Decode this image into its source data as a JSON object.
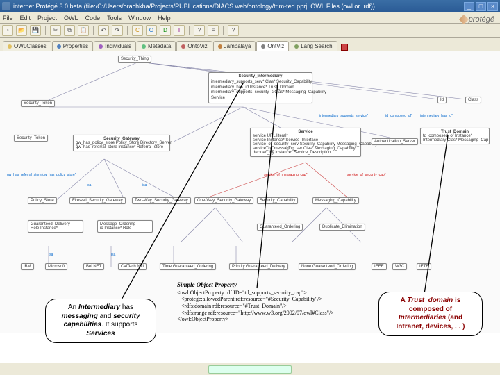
{
  "window": {
    "title": "internet Protégé 3.0 beta   (file:/C:/Users/orachkha/Projects/PUBLications/DIACS.web/ontology/trim-ted.pprj,  OWL Files (owl or .rdf))",
    "min": "_",
    "max": "□",
    "close": "×"
  },
  "menubar": [
    "File",
    "Edit",
    "Project",
    "OWL",
    "Code",
    "Tools",
    "Window",
    "Help"
  ],
  "toolbar_icons": [
    "doc",
    "open",
    "save",
    "sep",
    "cut",
    "copy",
    "paste",
    "sep",
    "undo",
    "redo",
    "sep",
    "c",
    "o",
    "c2",
    "t",
    "sep",
    "q",
    "list",
    "sep",
    "help"
  ],
  "tabs": [
    {
      "label": "OWLClasses",
      "color": "#e0c060"
    },
    {
      "label": "Properties",
      "color": "#5080c0"
    },
    {
      "label": "Individuals",
      "color": "#a060c0"
    },
    {
      "label": "Metadata",
      "color": "#60c080"
    },
    {
      "label": "OntoViz",
      "color": "#c06060"
    },
    {
      "label": "Jambalaya",
      "color": "#c08040"
    },
    {
      "label": "OntViz",
      "color": "#808080",
      "active": true
    },
    {
      "label": "Lang Search",
      "color": "#80a060"
    }
  ],
  "logo": "protégé",
  "nodes": {
    "security_thing": "Security_Thing",
    "security_intermediary": "Security_Intermediary",
    "si_row1": "intermediary_supports_serv*   Clas*   Security_Capability",
    "si_row2": "intermediary_has_id   Instance*   Trust_Domain",
    "si_row3": "intermediary_supports_security_c   Clas*   Messaging_Capability",
    "si_row4": "Service",
    "sec_token": "Security_Token",
    "id": "Id",
    "class_r": "Class",
    "edge_ism": "intermediary_supports_service*",
    "edge_comp": "td_composed_of*",
    "edge_hasid": "intermediary_has_id*",
    "security_token2": "Security_Token",
    "sec_gateway_blk_t": "Security_Gateway",
    "sg_r1": "gw_has_policy_store   Policy_Store   Directory_Server",
    "sg_r2": "gw_has_referral_store   Instance*   Referral_store",
    "service_blk_t": "Service",
    "sv_r1": "service URL                     literal*",
    "sv_r2": "service Instance*        Service_Interface",
    "sv_r3": "service_of_security_serv   Security_Capability   Messaging_Capability",
    "sv_r4": "service_of_messaging_ser   Clas*   Messaging_Capability",
    "sv_r5": "decided_by   Instance*   Service_Description",
    "auth_server": "Authentication_Server",
    "trust_domain_t": "Trust_Domain",
    "td_r1": "td_composed_of   Instance*",
    "td_r2": "Intermediary   Clas*   Messaging_Cap",
    "edge_red1": "service_of_messaging_cap*",
    "edge_red2": "service_of_security_cap*",
    "gw_referral": "gw_has_referral_store/gw_has_policy_store*",
    "policy_store": "Policy_Store",
    "firewall_gw": "Firewall_Security_Gateway",
    "two_way": "Two-Way_Security_Gateway",
    "one_way": "One-Way_Security_Gateway",
    "sec_cap": "Security_Capability",
    "msg_cap": "Messaging_Capability",
    "isa": "isa",
    "isa2": "isa",
    "isa3": "isa",
    "isa4": "isa",
    "isa5": "isa",
    "isa6": "isa",
    "guar_del": "Guaranteed_Delivery",
    "msg_ord": "Message_Ordering",
    "guar_ord": "Guaranteed_Ordering",
    "dup_elim": "Duplicate_Elimination",
    "role": "Role  Instance*",
    "io": "io  Instance*  Role",
    "instance_boxes": [
      "IBM",
      "Microsoft",
      "Bel.NET",
      "CalTech.NTI",
      "Time.Guaranteed_Ordering",
      "Priority.Guaranteed_Delivery",
      "None.Guaranteed_Ordering",
      "IEEE",
      "W3C",
      "IETF"
    ],
    "callout_left": "An <b class='i'>Intermediary</b> has <b class='i'>messaging</b> and <b class='i'>security capabilities</b>. It supports <b class='i'>Services</b>",
    "code_header": "Simple Object Property",
    "code_body": "<owl:ObjectProperty rdf:ID=\"td_supports_security_cap\">\n   <protege:allowedParent rdf:resource=\"#Security_Capability\"/>\n   <rdfs:domain rdf:resource=\"#Trust_Domain\"/>\n   <rdfs:range rdf:resource=\"http://www.w3.org/2002/07/owl#Class\"/>\n</owl:ObjectProperty>",
    "callout_right": "A <span class='em'>Trust_domain</span> is composed of <span class='em'>Intermediaries</span> (and Intranet, devices, . . )"
  }
}
